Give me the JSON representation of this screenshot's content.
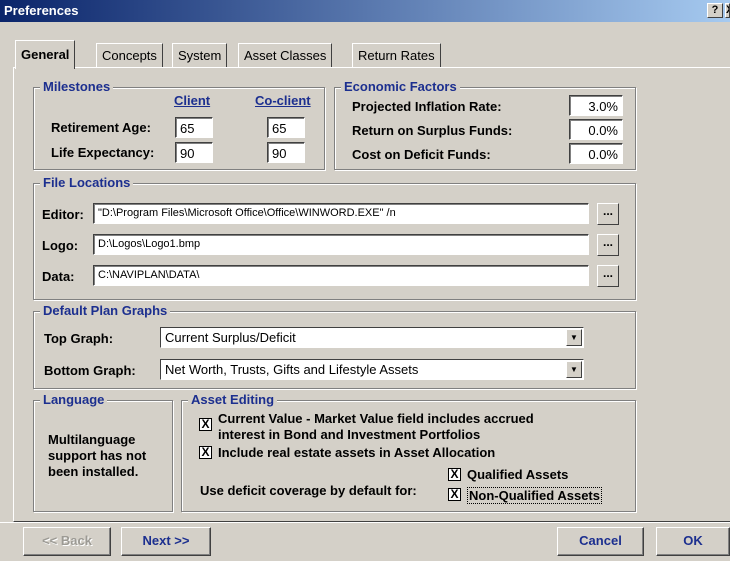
{
  "window": {
    "title": "Preferences",
    "help_glyph": "?",
    "close_glyph": "X"
  },
  "tabs": [
    {
      "label": "General",
      "active": true
    },
    {
      "label": "Concepts",
      "active": false
    },
    {
      "label": "System",
      "active": false
    },
    {
      "label": "Asset Classes",
      "active": false
    },
    {
      "label": "Return Rates",
      "active": false
    }
  ],
  "milestones": {
    "title": "Milestones",
    "client_header": "Client",
    "coclient_header": "Co-client",
    "retirement_label": "Retirement Age:",
    "life_label": "Life Expectancy:",
    "retirement_client": "65",
    "retirement_coclient": "65",
    "life_client": "90",
    "life_coclient": "90"
  },
  "economic": {
    "title": "Economic Factors",
    "inflation_label": "Projected Inflation Rate:",
    "inflation_value": "3.0%",
    "surplus_label": "Return on Surplus Funds:",
    "surplus_value": "0.0%",
    "deficit_label": "Cost on Deficit Funds:",
    "deficit_value": "0.0%"
  },
  "files": {
    "title": "File Locations",
    "editor_label": "Editor:",
    "editor_value": "\"D:\\Program Files\\Microsoft Office\\Office\\WINWORD.EXE\" /n",
    "logo_label": "Logo:",
    "logo_value": "D:\\Logos\\Logo1.bmp",
    "data_label": "Data:",
    "data_value": "C:\\NAVIPLAN\\DATA\\",
    "browse_label": "..."
  },
  "graphs": {
    "title": "Default Plan Graphs",
    "top_label": "Top Graph:",
    "top_value": "Current Surplus/Deficit",
    "bottom_label": "Bottom Graph:",
    "bottom_value": "Net Worth, Trusts, Gifts and Lifestyle Assets",
    "arrow_glyph": "▼"
  },
  "language": {
    "title": "Language",
    "line1": "Multilanguage",
    "line2": "support has not",
    "line3": "been installed."
  },
  "asset_editing": {
    "title": "Asset Editing",
    "current_value_line1": "Current Value - Market Value field includes accrued",
    "current_value_line2": "interest in Bond and Investment Portfolios",
    "real_estate": "Include real estate assets in Asset Allocation",
    "deficit_label": "Use deficit coverage by default for:",
    "qualified": "Qualified Assets",
    "non_qualified": "Non-Qualified Assets",
    "check_glyph": "X"
  },
  "buttons": {
    "back": "<< Back",
    "next": "Next >>",
    "cancel": "Cancel",
    "ok": "OK"
  }
}
